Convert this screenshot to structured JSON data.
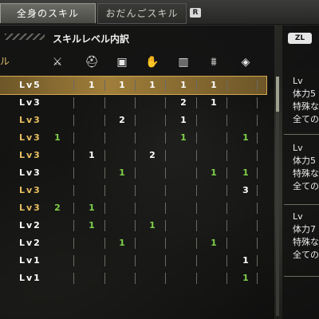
{
  "tabs": [
    {
      "label": "全身のスキル",
      "active": true
    },
    {
      "label": "おだんごスキル",
      "active": false
    }
  ],
  "tab_switch_button": "R",
  "panel": {
    "title": "スキルレベル内訳",
    "left_header": "ル"
  },
  "equipment_icons": [
    "weapon-icon",
    "helm-icon",
    "chest-icon",
    "arm-icon",
    "waist-icon",
    "leg-icon",
    "talisman-icon"
  ],
  "rows": [
    {
      "level": "Lv5",
      "cells": [
        "",
        "1",
        "1",
        "1",
        "1",
        "1",
        ""
      ],
      "color": "#ffffff",
      "selected": true
    },
    {
      "level": "Lv3",
      "cells": [
        "",
        "",
        "",
        "",
        "2",
        "1",
        ""
      ],
      "color": "#ffffff"
    },
    {
      "level": "Lv3",
      "cells": [
        "",
        "",
        "2",
        "",
        "1",
        "",
        ""
      ],
      "color": "#e8c060"
    },
    {
      "level": "Lv3",
      "cells": [
        "1",
        "",
        "",
        "",
        "1",
        "",
        "1"
      ],
      "color": "#e8c060"
    },
    {
      "level": "Lv3",
      "cells": [
        "",
        "1",
        "",
        "2",
        "",
        "",
        ""
      ],
      "color": "#e8c060"
    },
    {
      "level": "Lv3",
      "cells": [
        "",
        "",
        "1",
        "",
        "",
        "1",
        "1"
      ],
      "color": "#ffffff"
    },
    {
      "level": "Lv3",
      "cells": [
        "",
        "",
        "",
        "",
        "",
        "",
        "3"
      ],
      "color": "#e8c060"
    },
    {
      "level": "Lv3",
      "cells": [
        "2",
        "1",
        "",
        "",
        "",
        "",
        ""
      ],
      "color": "#e8c060"
    },
    {
      "level": "Lv2",
      "cells": [
        "",
        "1",
        "",
        "1",
        "",
        "",
        ""
      ],
      "color": "#ffffff"
    },
    {
      "level": "Lv2",
      "cells": [
        "",
        "",
        "1",
        "",
        "",
        "1",
        ""
      ],
      "color": "#ffffff"
    },
    {
      "level": "Lv1",
      "cells": [
        "",
        "",
        "",
        "",
        "",
        "",
        "1"
      ],
      "color": "#ffffff"
    },
    {
      "level": "Lv1",
      "cells": [
        "",
        "",
        "",
        "",
        "",
        "",
        "1"
      ],
      "color": "#ffffff"
    }
  ],
  "cell_colors": {
    "white_values": [
      "#ffffff"
    ],
    "green": "#7fd04a"
  },
  "right_panel": {
    "button_label": "ZL",
    "blocks": [
      {
        "line1": "Lv",
        "line2": "体力5",
        "line3": "特殊な",
        "line4": "全ての"
      },
      {
        "line1": "Lv",
        "line2": "体力5",
        "line3": "特殊な",
        "line4": "全ての"
      },
      {
        "line1": "Lv",
        "line2": "体力7",
        "line3": "特殊な",
        "line4": "全ての"
      }
    ]
  }
}
